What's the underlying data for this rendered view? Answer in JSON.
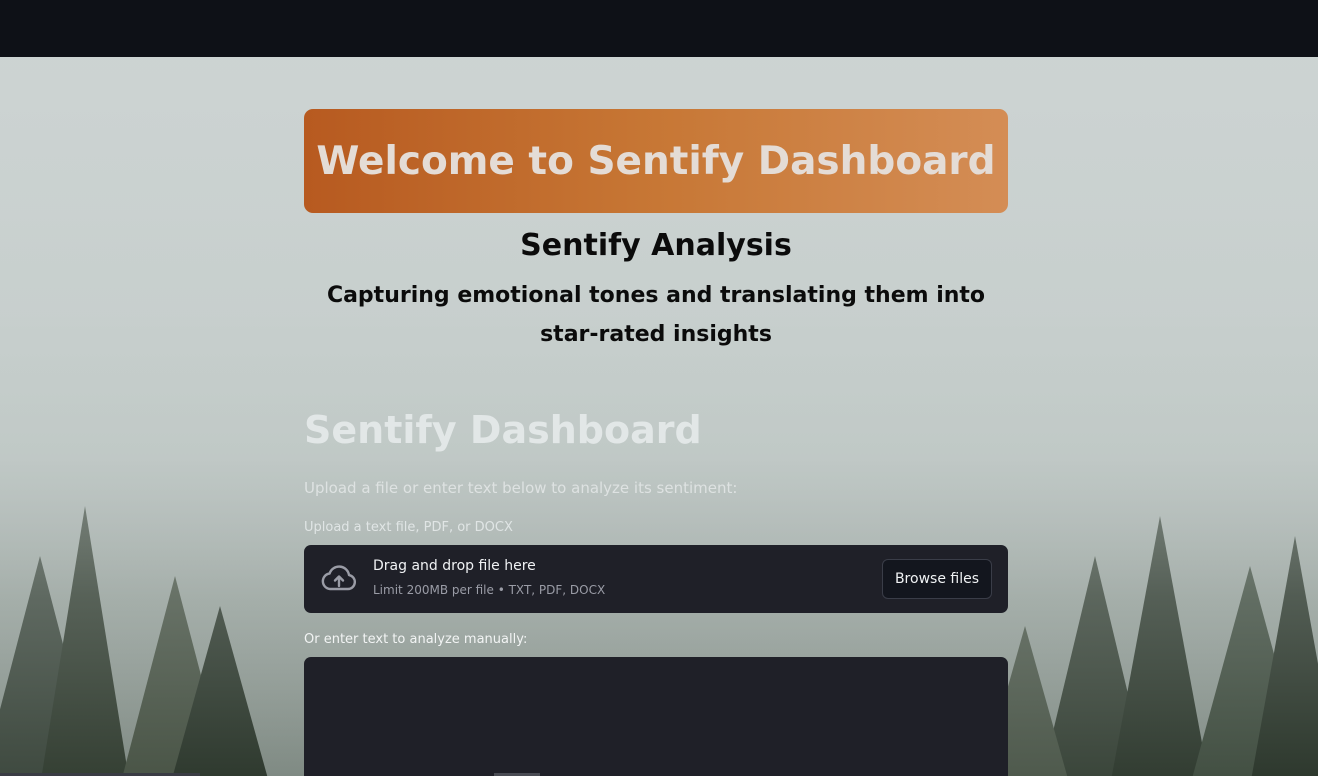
{
  "banner": {
    "title": "Welcome to Sentify Dashboard"
  },
  "analysis": {
    "title": "Sentify Analysis",
    "subtitle": "Capturing emotional tones and translating them into star-rated insights"
  },
  "dashboard": {
    "heading": "Sentify Dashboard",
    "intro": "Upload a file or enter text below to analyze its sentiment:"
  },
  "uploader": {
    "label": "Upload a text file, PDF, or DOCX",
    "drop_text": "Drag and drop file here",
    "limit_text": "Limit 200MB per file • TXT, PDF, DOCX",
    "browse_label": "Browse files",
    "icon": "cloud-upload-icon"
  },
  "manual_input": {
    "label": "Or enter text to analyze manually:",
    "value": ""
  },
  "colors": {
    "banner_start": "#b75a20",
    "banner_end": "#d48d55",
    "panel_bg": "#1f2028",
    "topbar_bg": "#0e1117"
  }
}
